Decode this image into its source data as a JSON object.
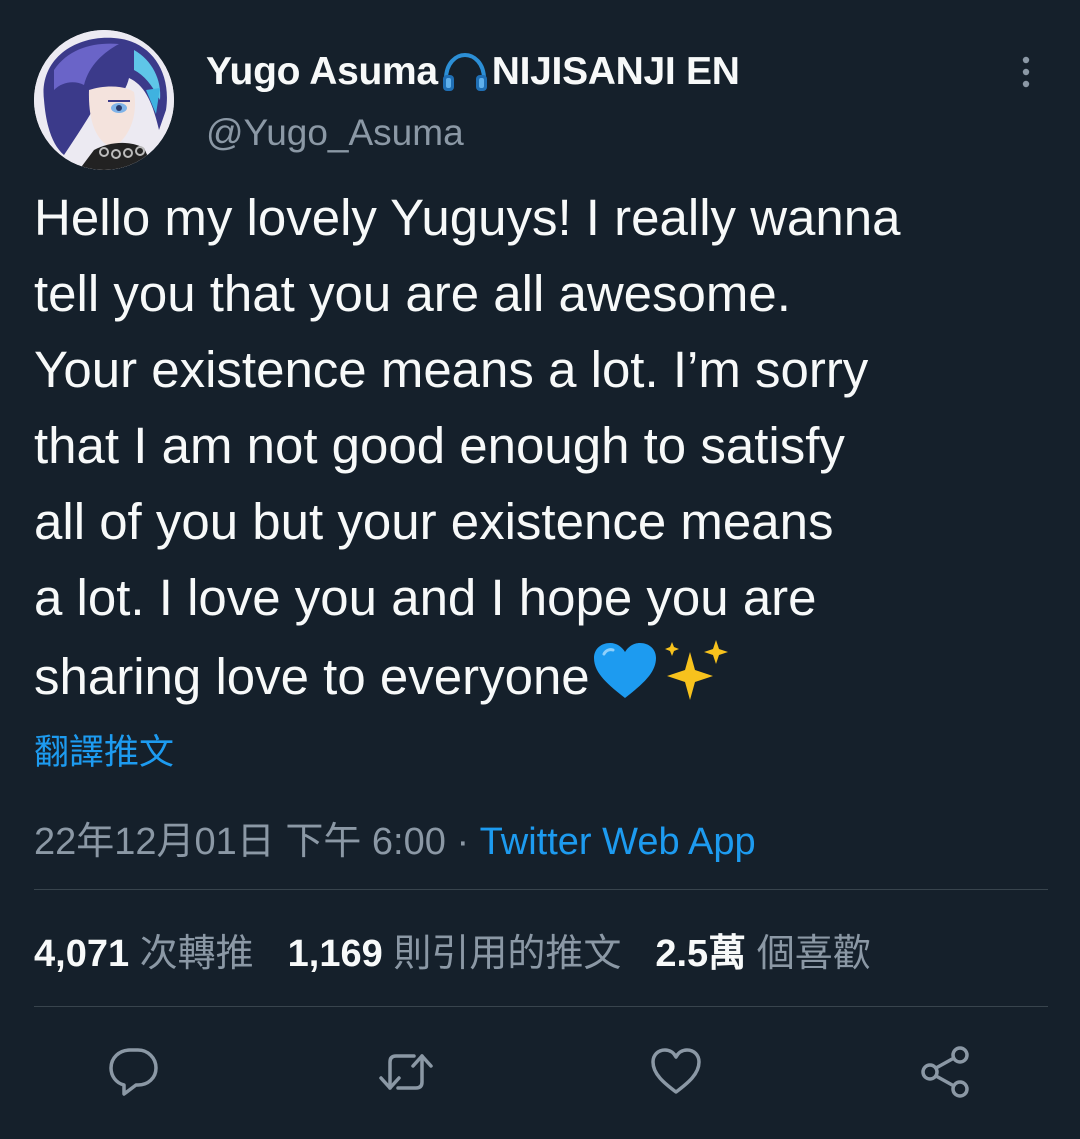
{
  "user": {
    "display_name": "Yugo Asuma",
    "display_name_suffix": "NIJISANJI EN",
    "handle": "@Yugo_Asuma",
    "avatar_icon": "avatar-image",
    "name_emoji": "headphone-icon"
  },
  "tweet": {
    "lines": [
      "Hello my lovely Yuguys! I really wanna",
      "tell you that you are all awesome.",
      "Your existence means a lot. I’m sorry",
      "that I am not good enough to satisfy",
      "all of you but your existence means",
      "a lot. I love you and I hope you are",
      "sharing love to everyone"
    ],
    "trailing_emojis": [
      "blue-heart-icon",
      "sparkles-icon"
    ]
  },
  "translate_label": "翻譯推文",
  "meta": {
    "timestamp": "22年12月01日 下午 6:00",
    "separator": "·",
    "source": "Twitter Web App"
  },
  "stats": {
    "retweets_count": "4,071",
    "retweets_label": "次轉推",
    "quotes_count": "1,169",
    "quotes_label": "則引用的推文",
    "likes_count": "2.5萬",
    "likes_label": "個喜歡"
  },
  "actions": [
    "reply-icon",
    "retweet-icon",
    "like-icon",
    "share-icon"
  ],
  "colors": {
    "background": "#15202b",
    "text": "#f7f9f9",
    "secondary": "#8b98a5",
    "accent": "#1d9bf0",
    "divider": "#38444d"
  }
}
